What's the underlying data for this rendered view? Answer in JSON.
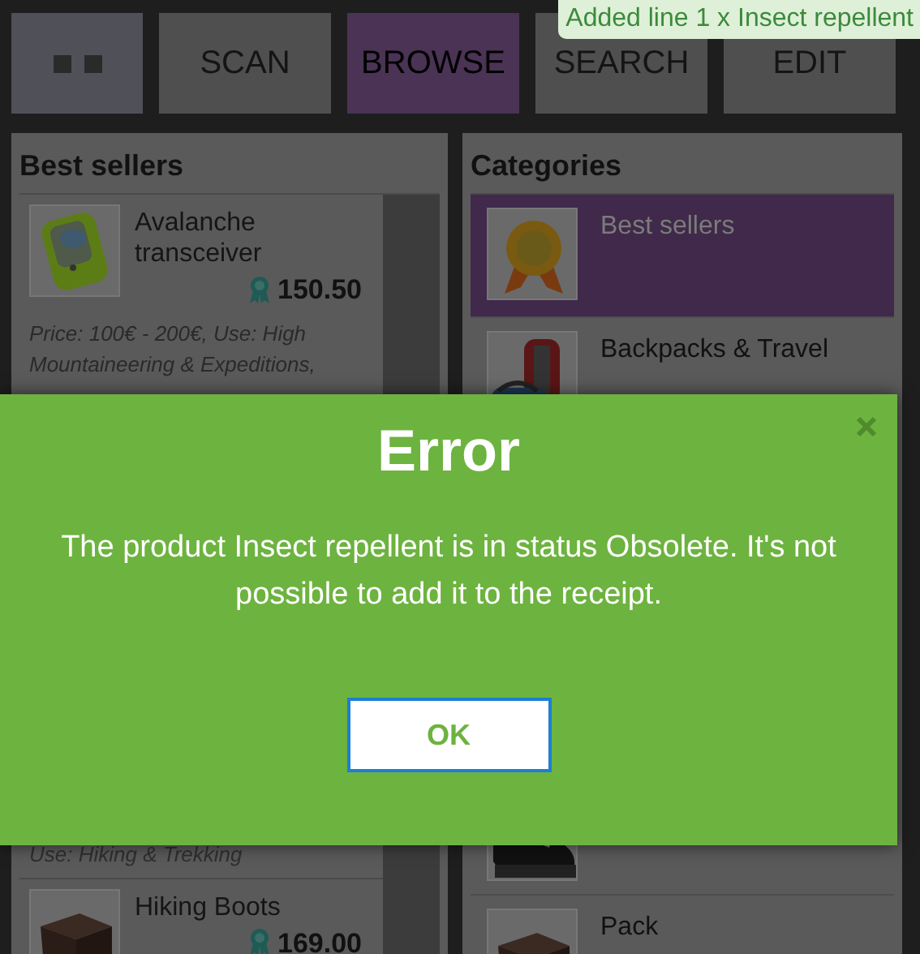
{
  "toast": "Added line 1 x Insect repellent",
  "toolbar": [
    {
      "kind": "menu",
      "selected": false
    },
    {
      "kind": "text",
      "label": "SCAN",
      "selected": false
    },
    {
      "kind": "text",
      "label": "BROWSE",
      "selected": true
    },
    {
      "kind": "text",
      "label": "SEARCH",
      "selected": false
    },
    {
      "kind": "text",
      "label": "EDIT",
      "selected": false
    }
  ],
  "best_sellers": {
    "title": "Best sellers",
    "products": [
      {
        "kind": "full",
        "name": "Avalanche transceiver",
        "price": "150.50",
        "description": "Price: 100€ - 200€, Use: High Mountaineering & Expeditions,"
      },
      {
        "kind": "tail",
        "description": "Use: Hiking & Trekking"
      },
      {
        "kind": "full",
        "name": "Hiking Boots",
        "price": "169.00"
      }
    ]
  },
  "categories": {
    "title": "Categories",
    "items": [
      {
        "kind": "medal",
        "name": "Best sellers",
        "selected": true
      },
      {
        "kind": "backpack",
        "name": "Backpacks & Travel",
        "selected": false
      },
      {
        "kind": "shoe",
        "selected": false
      },
      {
        "kind": "box",
        "name": "Pack",
        "selected": false
      }
    ]
  },
  "dialog": {
    "title": "Error",
    "message": "The product Insect repellent is in status Obsolete. It's not possible to add it to the receipt.",
    "button": "OK"
  }
}
